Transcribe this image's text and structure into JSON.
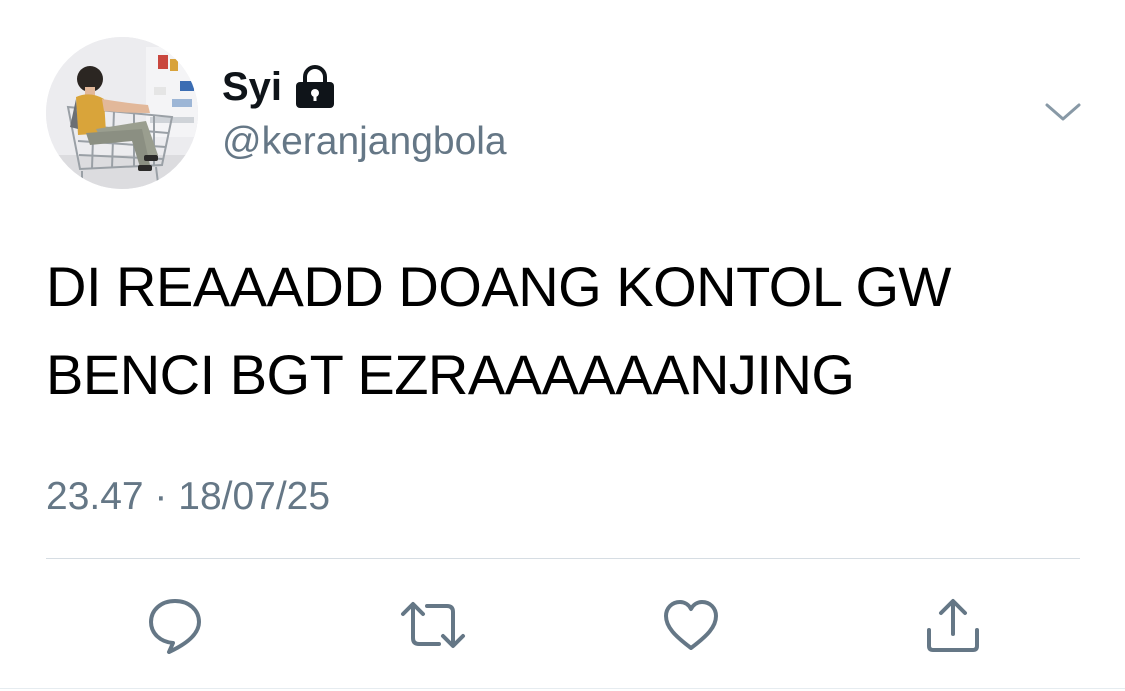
{
  "user": {
    "display_name": "Syi",
    "handle": "@keranjangbola",
    "protected": true
  },
  "tweet": {
    "text_line1": "DI REAAADD DOANG KONTOL GW",
    "text_line2": "BENCI BGT EZRAAAAAANJING",
    "timestamp": "23.47 · 18/07/25"
  },
  "icons": {
    "lock": "lock-icon",
    "more": "chevron-down-icon",
    "reply": "reply-icon",
    "retweet": "retweet-icon",
    "like": "heart-icon",
    "share": "share-icon"
  },
  "colors": {
    "primary_text": "#0f1419",
    "secondary_text": "#657786",
    "icon_gray": "#657786",
    "divider": "#d6dde3"
  }
}
